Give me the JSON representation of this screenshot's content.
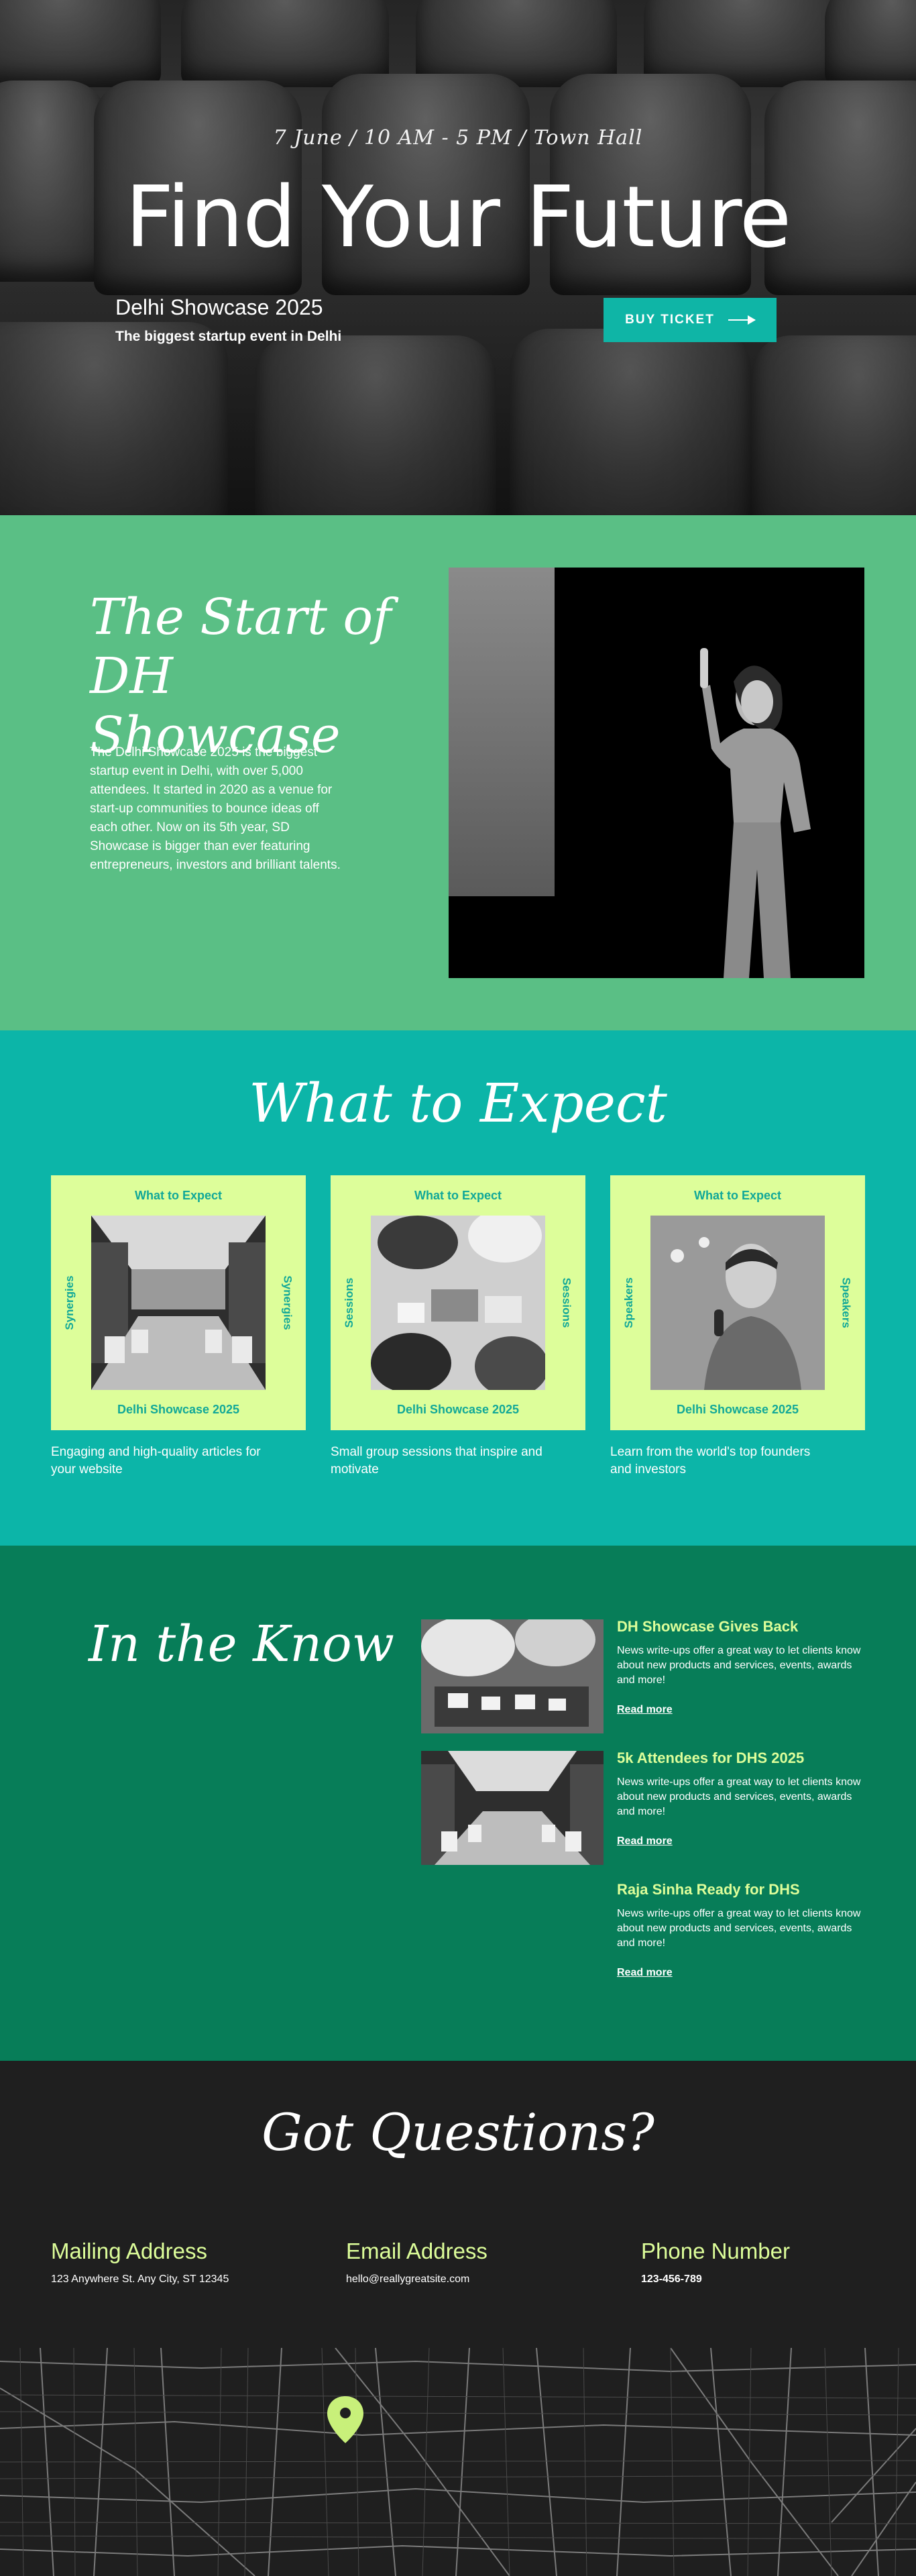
{
  "hero": {
    "meta": "7 June / 10 AM - 5 PM / Town Hall",
    "title": "Find Your Future",
    "event_name": "Delhi Showcase 2025",
    "tagline": "The biggest startup event in Delhi",
    "ticket_button": "BUY TICKET"
  },
  "about": {
    "title_line1": "The Start of",
    "title_line2": "DH Showcase",
    "body": "The Delhi Showcase 2025 is the biggest startup event in Delhi, with over 5,000 attendees. It started in 2020 as a venue for start-up communities to bounce ideas off each other. Now on its 5th year, SD Showcase is bigger than ever featuring entrepreneurs, investors and brilliant talents."
  },
  "expect": {
    "title": "What to Expect",
    "cards": [
      {
        "top": "What to Expect",
        "side": "Synergies",
        "bottom": "Delhi Showcase 2025",
        "description": "Engaging and high-quality articles for your website"
      },
      {
        "top": "What to Expect",
        "side": "Sessions",
        "bottom": "Delhi Showcase 2025",
        "description": "Small group sessions that inspire and motivate"
      },
      {
        "top": "What to Expect",
        "side": "Speakers",
        "bottom": "Delhi Showcase 2025",
        "description": "Learn from the world's top founders and investors"
      }
    ]
  },
  "know": {
    "title": "In the Know",
    "items": [
      {
        "headline": "DH Showcase Gives Back",
        "body": "News write-ups offer a great way to let clients know about new products and services, events, awards and more!",
        "link": "Read more"
      },
      {
        "headline": "5k Attendees for DHS 2025",
        "body": "News write-ups offer a great way to let clients know about new products and services, events, awards and more!",
        "link": "Read more"
      },
      {
        "headline": "Raja Sinha Ready for DHS",
        "body": "News write-ups offer a great way to let clients know about new products and services, events, awards and more!",
        "link": "Read more"
      }
    ]
  },
  "contact": {
    "title": "Got Questions?",
    "mailing": {
      "label": "Mailing Address",
      "value": "123 Anywhere St. Any City, ST 12345"
    },
    "email": {
      "label": "Email Address",
      "value": "hello@reallygreatsite.com"
    },
    "phone": {
      "label": "Phone Number",
      "value": "123-456-789"
    }
  },
  "colors": {
    "teal": "#0cb5a8",
    "green": "#5abf85",
    "dark_green": "#077d58",
    "lime": "#ddfe9a",
    "dark": "#1f1f1f"
  },
  "icons": [
    "arrow-right-icon",
    "map-pin-icon"
  ]
}
